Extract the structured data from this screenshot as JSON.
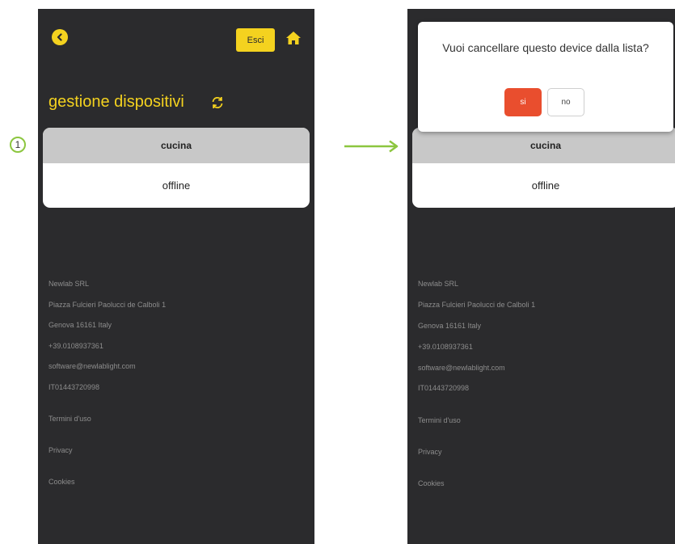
{
  "step_number": "1",
  "colors": {
    "accent": "#f4d21f",
    "background": "#2b2b2d",
    "danger": "#e94e2e",
    "arrow": "#8cc63f"
  },
  "left_screen": {
    "header": {
      "back_icon": "chevron-left-icon",
      "exit_label": "Esci",
      "home_icon": "home-icon"
    },
    "title": "gestione dispositivi",
    "refresh_icon": "refresh-icon",
    "device": {
      "name": "cucina",
      "status": "offline"
    },
    "footer": [
      "Newlab SRL",
      "Piazza Fulcieri Paolucci de Calboli 1",
      "Genova 16161 Italy",
      "+39.0108937361",
      "software@newlablight.com",
      "IT01443720998",
      "Termini d'uso",
      "Privacy",
      "Cookies"
    ]
  },
  "right_screen": {
    "dialog": {
      "message": "Vuoi cancellare questo device dalla lista?",
      "yes_label": "si",
      "no_label": "no"
    },
    "device": {
      "name": "cucina",
      "status": "offline"
    },
    "footer": [
      "Newlab SRL",
      "Piazza Fulcieri Paolucci de Calboli 1",
      "Genova 16161 Italy",
      "+39.0108937361",
      "software@newlablight.com",
      "IT01443720998",
      "Termini d'uso",
      "Privacy",
      "Cookies"
    ]
  }
}
